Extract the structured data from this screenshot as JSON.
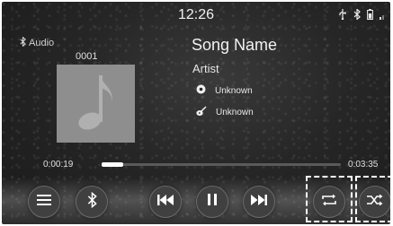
{
  "status": {
    "time": "12:26",
    "icons": [
      "usb-icon",
      "bluetooth-icon",
      "phone-battery-icon",
      "signal-icon"
    ]
  },
  "source": {
    "label": "Audio",
    "icon": "bluetooth-icon"
  },
  "track": {
    "number": "0001",
    "song_name": "Song Name",
    "artist": "Artist",
    "album": "Unknown",
    "genre": "Unknown"
  },
  "progress": {
    "elapsed": "0:00:19",
    "total": "0:03:35",
    "fraction": 0.09
  },
  "controls": [
    {
      "name": "menu-button",
      "icon": "menu-icon"
    },
    {
      "name": "bluetooth-button",
      "icon": "bluetooth-icon"
    },
    {
      "name": "previous-track-button",
      "icon": "skip-back-icon"
    },
    {
      "name": "pause-button",
      "icon": "pause-icon"
    },
    {
      "name": "next-track-button",
      "icon": "skip-forward-icon"
    },
    {
      "name": "repeat-button",
      "icon": "repeat-icon",
      "highlighted": true
    },
    {
      "name": "shuffle-button",
      "icon": "shuffle-icon",
      "highlighted": true
    }
  ],
  "colors": {
    "background": "#262626",
    "text": "#f2f2f2",
    "album_art": "#8e8e8e",
    "progress_fill": "#ffffff"
  }
}
